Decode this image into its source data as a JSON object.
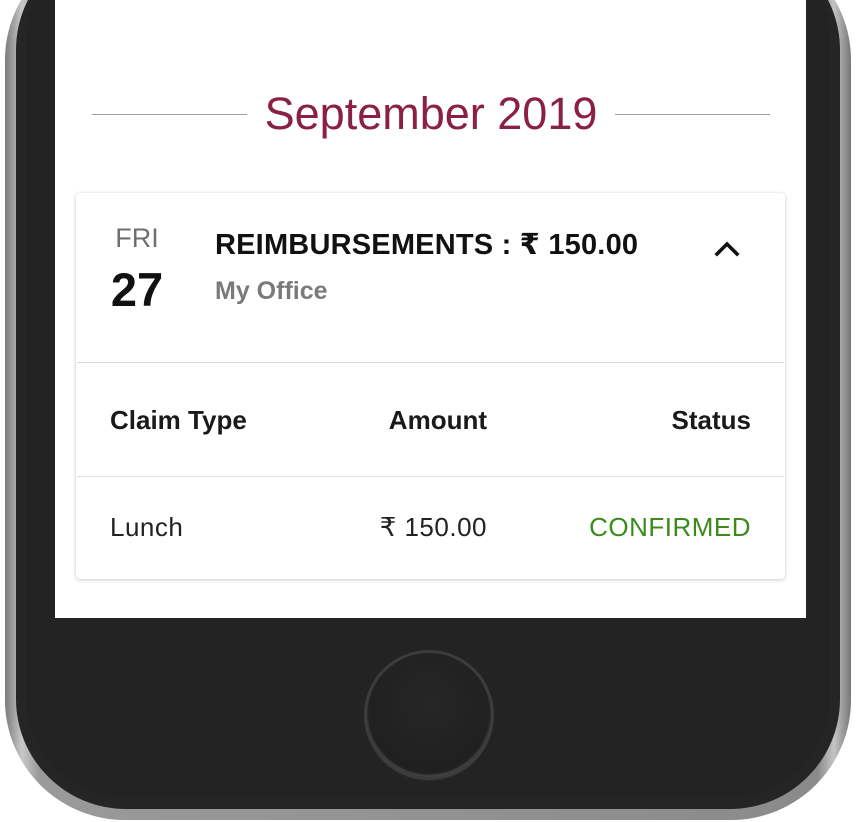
{
  "month_header": "September 2019",
  "card": {
    "day_name": "FRI",
    "day_number": "27",
    "title": "REIMBURSEMENTS : ₹ 150.00",
    "location": "My Office",
    "toggle_icon": "chevron-up-icon"
  },
  "table": {
    "headers": [
      "Claim Type",
      "Amount",
      "Status"
    ],
    "rows": [
      {
        "claim_type": "Lunch",
        "amount": "₹ 150.00",
        "status": "CONFIRMED"
      }
    ]
  },
  "colors": {
    "accent": "#8b2046",
    "status_confirmed": "#3c8a1b"
  }
}
